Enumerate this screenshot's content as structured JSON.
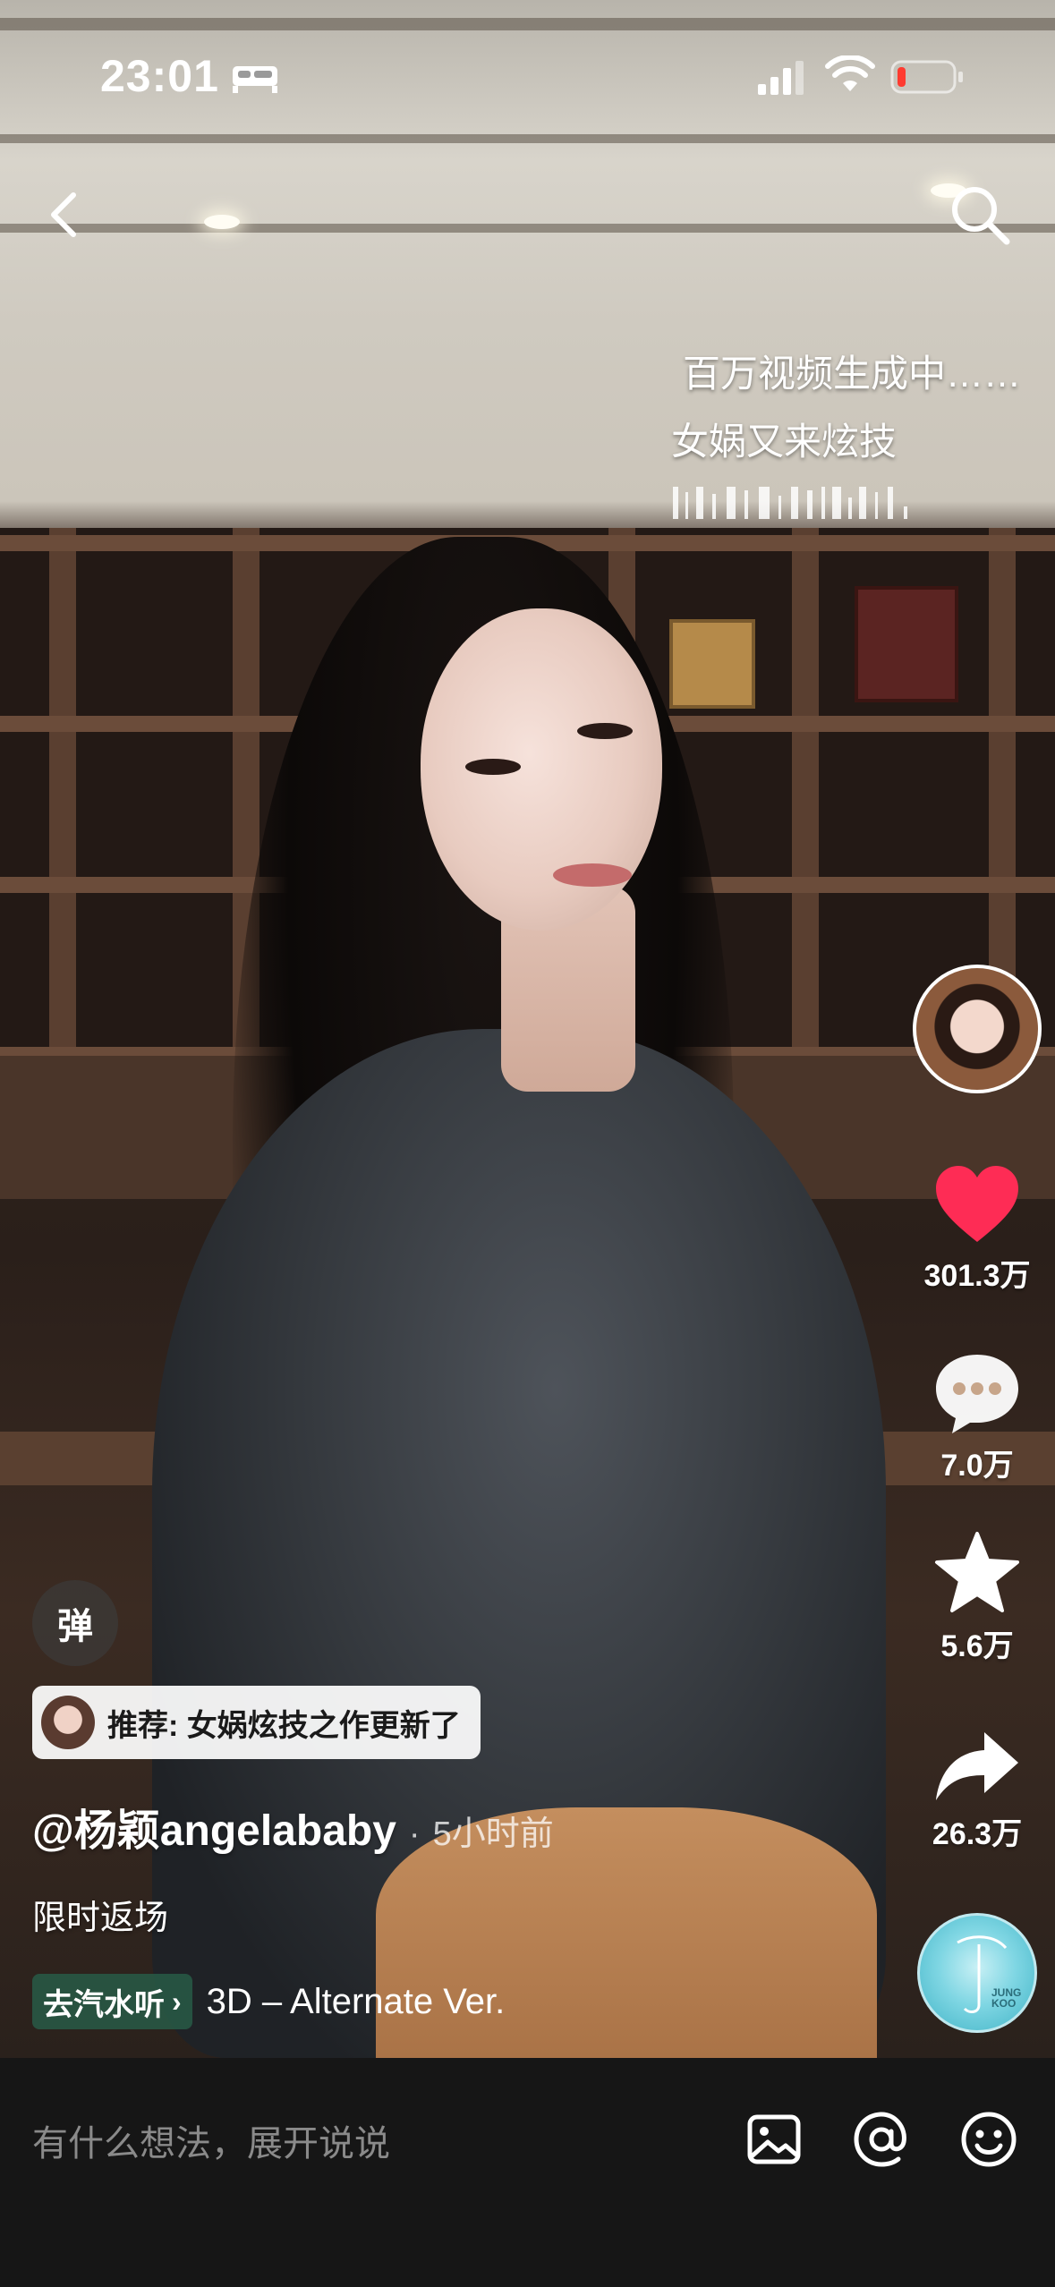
{
  "status_bar": {
    "time": "23:01",
    "sleep_icon": "bed-icon",
    "signal_icon": "cellular-signal-icon",
    "wifi_icon": "wifi-icon",
    "battery_icon": "battery-low-icon",
    "battery_color": "#ff3b30"
  },
  "nav": {
    "back_icon": "chevron-left-icon",
    "search_icon": "search-icon"
  },
  "captions": {
    "line1": "百万视频生成中……",
    "line2": "女娲又来炫技"
  },
  "actions": {
    "like_count": "301.3万",
    "comment_count": "7.0万",
    "favorite_count": "5.6万",
    "share_count": "26.3万",
    "like_color": "#fe2c55"
  },
  "music_disc": {
    "logo_line1": "JUNG",
    "logo_line2": "KOO"
  },
  "danmaku": {
    "label": "弹"
  },
  "recommend": {
    "text": "推荐: 女娲炫技之作更新了"
  },
  "post": {
    "author": "@杨颖angelababy",
    "time": "5小时前",
    "description": "限时返场"
  },
  "music": {
    "button_label": "去汽水听",
    "title": "3D – Alternate Ver."
  },
  "comment_bar": {
    "placeholder": "有什么想法，展开说说",
    "image_icon": "image-icon",
    "mention_icon": "at-mention-icon",
    "emoji_icon": "emoji-icon"
  }
}
